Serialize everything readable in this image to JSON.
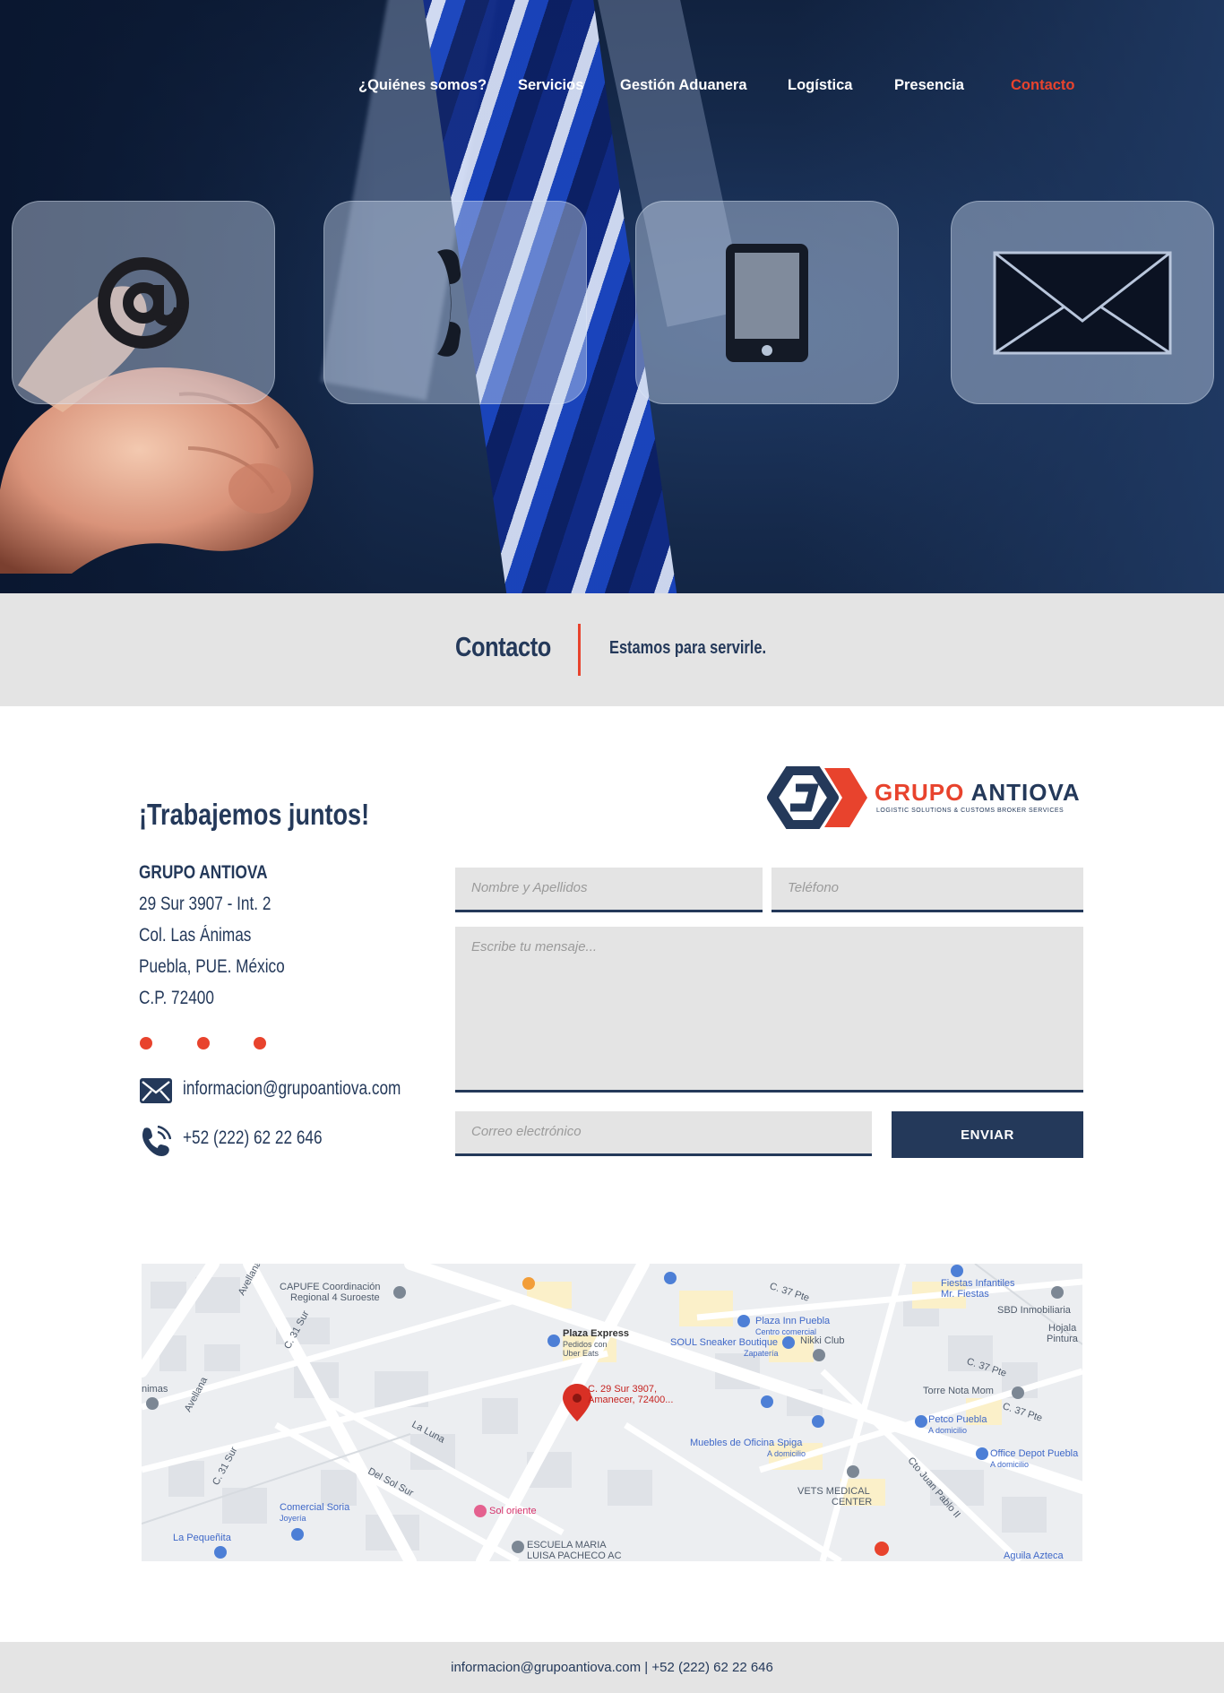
{
  "nav": {
    "items": [
      {
        "label": "¿Quiénes somos?"
      },
      {
        "label": "Servicios"
      },
      {
        "label": "Gestión Aduanera"
      },
      {
        "label": "Logística"
      },
      {
        "label": "Presencia"
      },
      {
        "label": "Contacto",
        "active": true
      }
    ],
    "active_color": "#e8432d"
  },
  "hero": {
    "tiles": [
      {
        "icon": "at-sign-icon"
      },
      {
        "icon": "phone-handset-icon"
      },
      {
        "icon": "mobile-phone-icon"
      },
      {
        "icon": "envelope-icon"
      }
    ]
  },
  "band": {
    "title": "Contacto",
    "subtitle": "Estamos para servirle."
  },
  "info": {
    "heading": "¡Trabajemos juntos!",
    "company": "GRUPO ANTIOVA",
    "address": [
      "29 Sur 3907 - Int. 2",
      "Col. Las Ánimas",
      "Puebla, PUE. México",
      "C.P. 72400"
    ],
    "email": "informacion@grupoantiova.com",
    "phone": "+52 (222) 62 22 646"
  },
  "logo": {
    "word1": "GRUPO",
    "word2": "ANTIOVA",
    "tagline": "LOGISTIC SOLUTIONS & CUSTOMS BROKER SERVICES"
  },
  "form": {
    "name_placeholder": "Nombre y Apellidos",
    "phone_placeholder": "Teléfono",
    "message_placeholder": "Escribe tu mensaje...",
    "email_placeholder": "Correo electrónico",
    "submit_label": "ENVIAR"
  },
  "map": {
    "pin_label": [
      "C. 29 Sur 3907,",
      "Amanecer, 72400..."
    ],
    "labels": [
      "CAPUFE Coordinación",
      "Regional 4 Suroeste",
      "Plaza Express",
      "Pedidos con",
      "Uber Eats",
      "SOUL Sneaker Boutique",
      "Zapatería",
      "Plaza Inn Puebla",
      "Centro comercial",
      "Nikki Club",
      "Fiestas Infantiles",
      "Mr. Fiestas",
      "SBD Inmobiliaria",
      "Hojala",
      "Pintura",
      "Torre Nota Mom",
      "Petco Puebla",
      "A domicilio",
      "Office Depot Puebla",
      "A domicilio",
      "Muebles de Oficina Spiga",
      "A domicilio",
      "VETS MEDICAL",
      "CENTER",
      "Comercial Soria",
      "Joyería",
      "La Pequeñita",
      "Sol oriente",
      "ESCUELA MARIA",
      "LUISA PACHECO AC",
      "Aguila Azteca",
      "La Luna",
      "Del Sol Sur",
      "C. 31 Sur",
      "C. 31 Sur",
      "Avellana",
      "Avellana",
      "Cto Juan Pablo II",
      "C. 37 Pte",
      "C. 37 Pte",
      "C. 37 Pte",
      "nimas"
    ]
  },
  "footer": {
    "text": "informacion@grupoantiova.com | +52 (222) 62 22 646"
  },
  "colors": {
    "navy": "#24395a",
    "accent_red": "#e8432d",
    "band_gray": "#e4e4e4"
  }
}
